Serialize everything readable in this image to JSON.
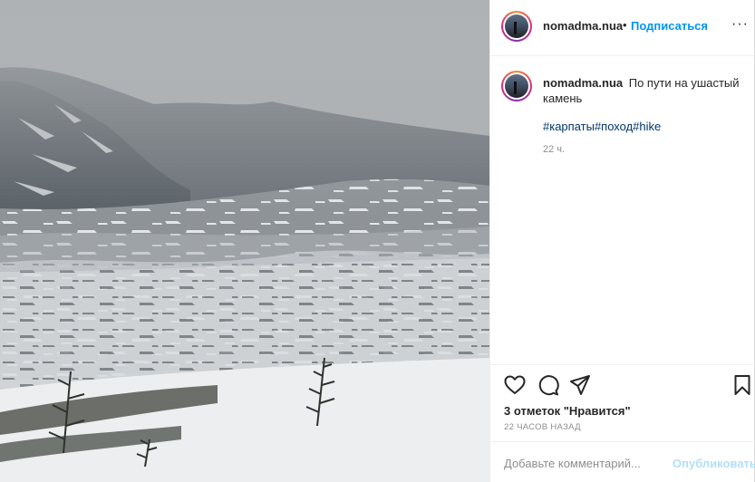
{
  "post": {
    "photo": {
      "description_icon": "mountain-photo",
      "colors": {
        "sky": "#a7abae",
        "mountain": "#5f666c",
        "snow": "#e4e6e8",
        "forest": "#3b3f36"
      }
    },
    "header": {
      "username": "nomadma.nua",
      "separator": "•",
      "follow_label": "Подписаться",
      "more_label": "···",
      "follow_color": "#0095f6"
    },
    "caption": {
      "username": "nomadma.nua",
      "text": "По пути на ушастый камень",
      "hashtags": "#карпаты#поход#hike",
      "time": "22 ч."
    },
    "actions": {
      "like_icon": "heart-icon",
      "comment_icon": "comment-icon",
      "share_icon": "share-icon",
      "save_icon": "bookmark-icon",
      "likes_text": "3 отметок \"Нравится\"",
      "time_ago": "22 ЧАСОВ НАЗАД"
    },
    "comment": {
      "placeholder": "Добавьте комментарий...",
      "publish_label": "Опубликовать"
    }
  }
}
